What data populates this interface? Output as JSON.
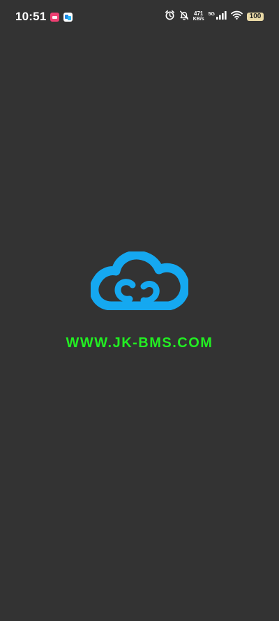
{
  "status_bar": {
    "time": "10:51",
    "net_speed_value": "471",
    "net_speed_unit": "KB/s",
    "network_type": "5G",
    "battery_level": "100"
  },
  "splash": {
    "url_text": "WWW.JK-BMS.COM"
  },
  "colors": {
    "background": "#333333",
    "logo_blue": "#15a8f0",
    "url_green": "#22ee22",
    "battery_fill": "#e9d9a6"
  },
  "icons": [
    "app-notification-icon-pink",
    "app-notification-icon-blue",
    "alarm-icon",
    "bell-muted-icon",
    "cellular-signal-icon",
    "wifi-icon",
    "battery-icon",
    "cloud-logo-icon"
  ]
}
